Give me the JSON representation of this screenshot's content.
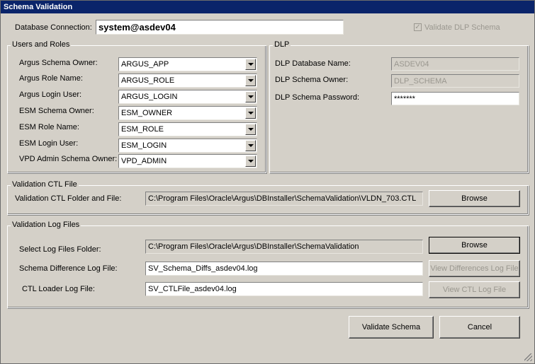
{
  "window": {
    "title": "Schema Validation"
  },
  "db_connection": {
    "label": "Database Connection:",
    "value": "system@asdev04"
  },
  "validate_dlp": {
    "label": "Validate DLP Schema",
    "checked": true
  },
  "users_roles": {
    "title": "Users and Roles",
    "rows": [
      {
        "label": "Argus Schema Owner:",
        "value": "ARGUS_APP"
      },
      {
        "label": "Argus Role Name:",
        "value": "ARGUS_ROLE"
      },
      {
        "label": "Argus Login User:",
        "value": "ARGUS_LOGIN"
      },
      {
        "label": "ESM Schema Owner:",
        "value": "ESM_OWNER"
      },
      {
        "label": "ESM Role Name:",
        "value": "ESM_ROLE"
      },
      {
        "label": "ESM Login User:",
        "value": "ESM_LOGIN"
      },
      {
        "label": "VPD Admin Schema Owner:",
        "value": "VPD_ADMIN"
      }
    ]
  },
  "dlp": {
    "title": "DLP",
    "db_name_label": "DLP Database Name:",
    "db_name_value": "ASDEV04",
    "owner_label": "DLP Schema Owner:",
    "owner_value": "DLP_SCHEMA",
    "password_label": "DLP Schema Password:",
    "password_value": "*******"
  },
  "ctl_file": {
    "title": "Validation CTL File",
    "label": "Validation CTL Folder and File:",
    "value": "C:\\Program Files\\Oracle\\Argus\\DBInstaller\\SchemaValidation\\VLDN_703.CTL",
    "browse": "Browse"
  },
  "log_files": {
    "title": "Validation Log Files",
    "folder_label": "Select Log Files Folder:",
    "folder_value": "C:\\Program Files\\Oracle\\Argus\\DBInstaller\\SchemaValidation",
    "browse": "Browse",
    "diff_label": "Schema Difference Log File:",
    "diff_value": "SV_Schema_Diffs_asdev04.log",
    "view_diff": "View Differences Log File",
    "ctl_label": "CTL Loader Log File:",
    "ctl_value": "SV_CTLFile_asdev04.log",
    "view_ctl": "View CTL Log File"
  },
  "actions": {
    "validate": "Validate Schema",
    "cancel": "Cancel"
  }
}
